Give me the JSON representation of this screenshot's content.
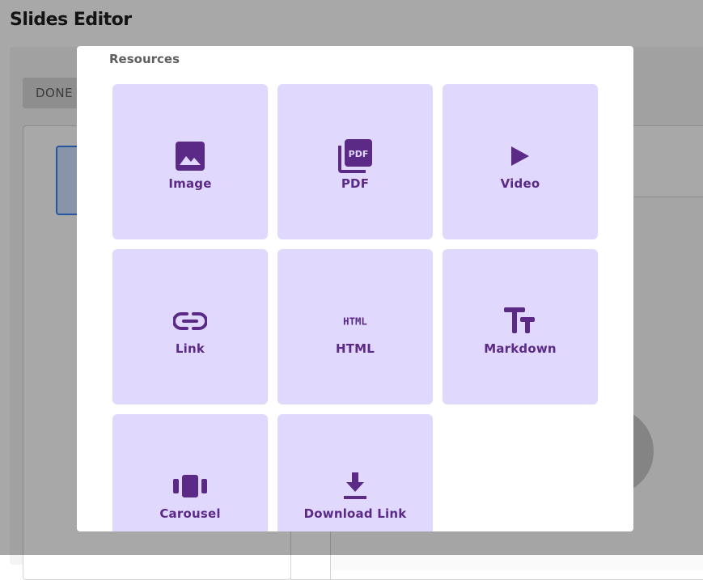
{
  "app": {
    "title": "Slides Editor",
    "done_label": "DONE"
  },
  "modal": {
    "heading": "Resources",
    "accent_color": "#5b2a86",
    "tile_color": "#e1d9fd",
    "tiles": [
      {
        "label": "Image",
        "icon": "image-icon"
      },
      {
        "label": "PDF",
        "icon": "pdf-icon"
      },
      {
        "label": "Video",
        "icon": "play-icon"
      },
      {
        "label": "Link",
        "icon": "link-icon"
      },
      {
        "label": "HTML",
        "icon": "html-icon"
      },
      {
        "label": "Markdown",
        "icon": "text-fields-icon"
      },
      {
        "label": "Carousel",
        "icon": "carousel-icon"
      },
      {
        "label": "Download Link",
        "icon": "download-icon"
      }
    ],
    "pdf_icon_text": "PDF",
    "html_icon_text": "HTML"
  }
}
